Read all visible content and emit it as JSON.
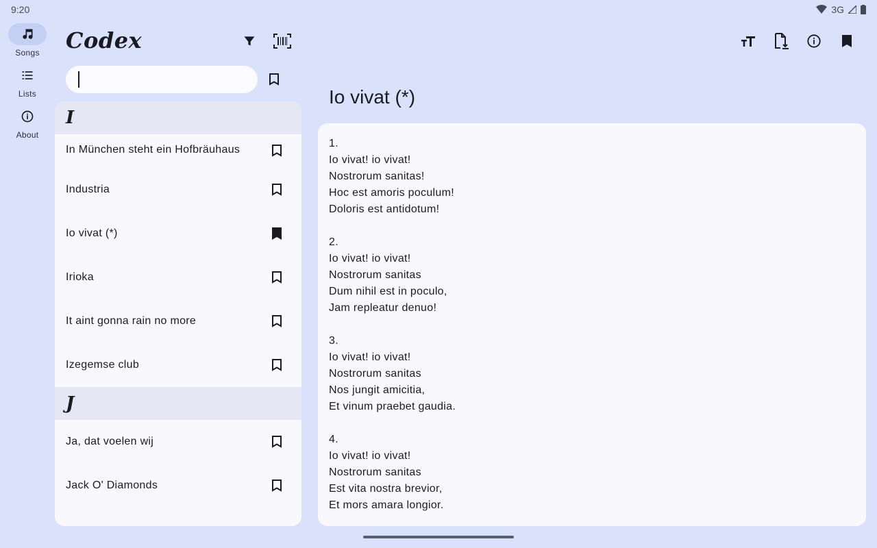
{
  "status": {
    "time": "9:20",
    "network": "3G"
  },
  "nav": {
    "items": [
      {
        "label": "Songs",
        "icon": "music-note-icon",
        "active": true
      },
      {
        "label": "Lists",
        "icon": "list-icon",
        "active": false
      },
      {
        "label": "About",
        "icon": "info-icon",
        "active": false
      }
    ]
  },
  "app": {
    "logo": "Codex"
  },
  "search": {
    "value": "",
    "placeholder": ""
  },
  "list": {
    "sections": [
      {
        "letter": "I",
        "songs": [
          {
            "title": "In München steht ein Hofbräuhaus",
            "bookmarked": false
          },
          {
            "title": "Industria",
            "bookmarked": false
          },
          {
            "title": "Io vivat (*)",
            "bookmarked": true
          },
          {
            "title": "Irioka",
            "bookmarked": false
          },
          {
            "title": "It aint gonna rain no more",
            "bookmarked": false
          },
          {
            "title": "Izegemse club",
            "bookmarked": false
          }
        ]
      },
      {
        "letter": "J",
        "songs": [
          {
            "title": "Ja, dat voelen wij",
            "bookmarked": false
          },
          {
            "title": "Jack O' Diamonds",
            "bookmarked": false
          }
        ]
      }
    ]
  },
  "detail": {
    "title": "Io vivat (*)",
    "lyrics": "1.\nIo vivat! io vivat!\nNostrorum sanitas!\nHoc est amoris poculum!\nDoloris est antidotum!\n\n2.\nIo vivat! io vivat!\nNostrorum sanitas\nDum nihil est in poculo,\nJam repleatur denuo!\n\n3.\nIo vivat! io vivat!\nNostrorum sanitas\nNos jungit amicitia,\nEt vinum praebet gaudia.\n\n4.\nIo vivat! io vivat!\nNostrorum sanitas\nEst vita nostra brevior,\nEt mors amara longior."
  },
  "colors": {
    "background": "#d9e1fb",
    "panel": "#f8f8fd",
    "section": "#e5e8f4",
    "active_rail": "#c5d0f5"
  }
}
